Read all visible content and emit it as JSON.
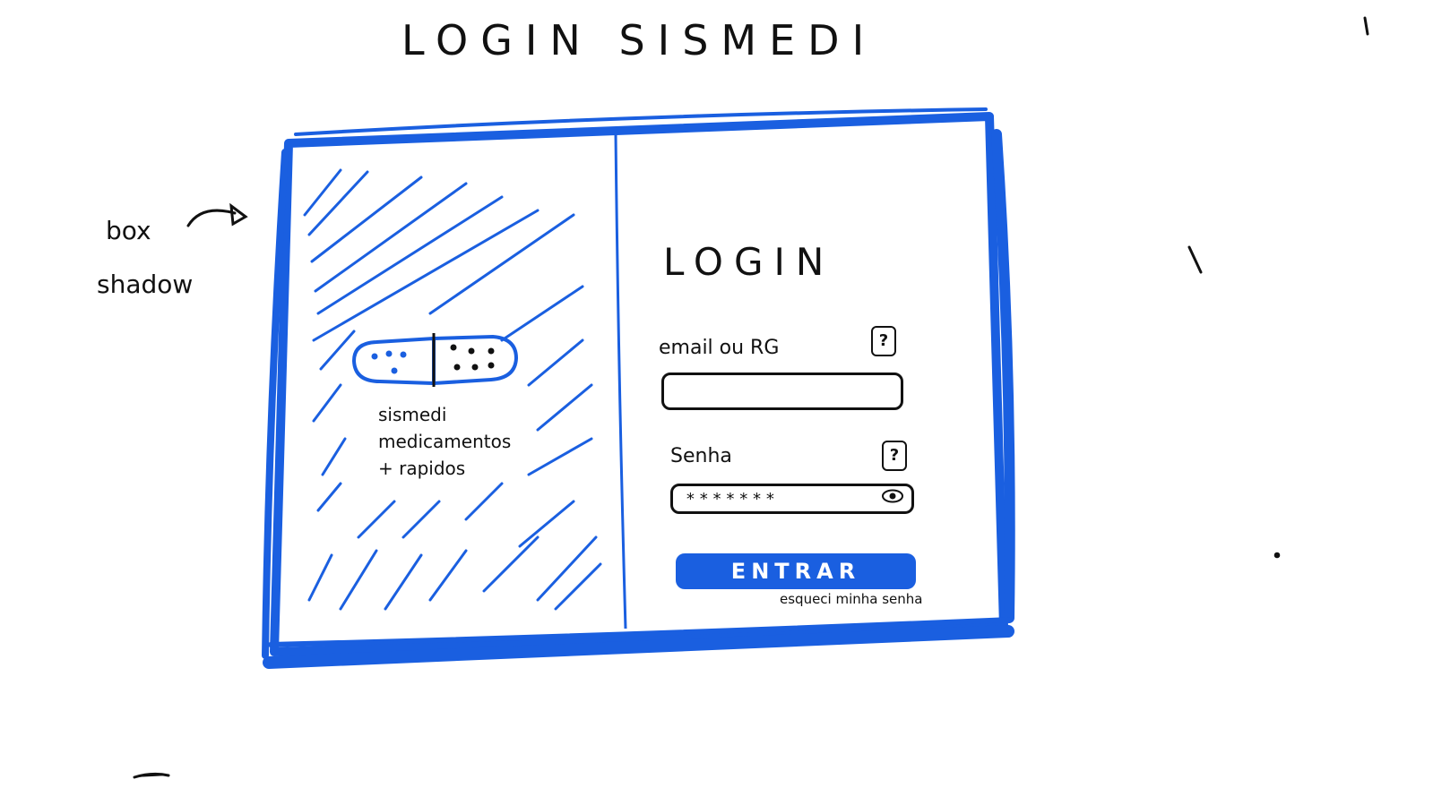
{
  "page_title": "LOGIN SISMEDI",
  "annotation": {
    "line1": "box",
    "line2": "shadow"
  },
  "brand": {
    "name": "sismedi",
    "tagline_line1": "medicamentos",
    "tagline_line2": "+ rapidos"
  },
  "login": {
    "heading": "LOGIN",
    "email_label": "email ou RG",
    "email_help": "?",
    "email_value": "",
    "password_label": "Senha",
    "password_help": "?",
    "password_value": "*******",
    "submit_label": "ENTRAR",
    "forgot_label": "esqueci minha senha"
  },
  "colors": {
    "accent": "#1a5fe0",
    "ink": "#111111",
    "background": "#ffffff"
  }
}
